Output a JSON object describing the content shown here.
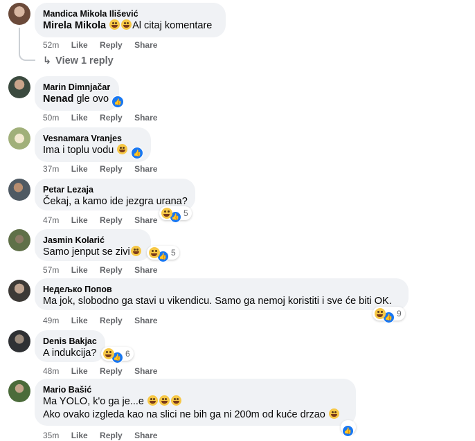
{
  "comments": [
    {
      "author": "Mandica Mikola Ilišević",
      "mention": "Mirela Mikola",
      "text": "Al citaj komentare",
      "time": "52m",
      "view_reply": "View 1 reply"
    },
    {
      "author": "Marin Dimnjačar",
      "mention": "Nenad",
      "text": "gle ovo",
      "time": "50m"
    },
    {
      "author": "Vesnamara Vranjes",
      "text": "Ima i toplu vodu",
      "time": "37m"
    },
    {
      "author": "Petar Lezaja",
      "text": "Čekaj, a kamo ide jezgra urana?",
      "time": "47m",
      "reactions": "5"
    },
    {
      "author": "Jasmin Kolarić",
      "text": "Samo jenput se zivi",
      "time": "57m",
      "reactions": "5"
    },
    {
      "author": "Недељко Попов",
      "text": "Ma jok, slobodno ga stavi u vikendicu. Samo ga nemoj koristiti i sve će biti OK.",
      "time": "49m",
      "reactions": "9"
    },
    {
      "author": "Denis Bakjac",
      "text": "A indukcija?",
      "time": "48m",
      "reactions": "6"
    },
    {
      "author": "Mario Bašić",
      "text": "Ma YOLO, k'o ga je...e",
      "text2": "Ako ovako izgleda kao na slici ne bih ga ni 200m od kuće drzao",
      "time": "35m"
    }
  ],
  "actions": {
    "like": "Like",
    "reply": "Reply",
    "share": "Share"
  },
  "colors": {
    "bubble": "#f0f2f5",
    "like_blue": "#1877f2",
    "meta_gray": "#65676b"
  }
}
